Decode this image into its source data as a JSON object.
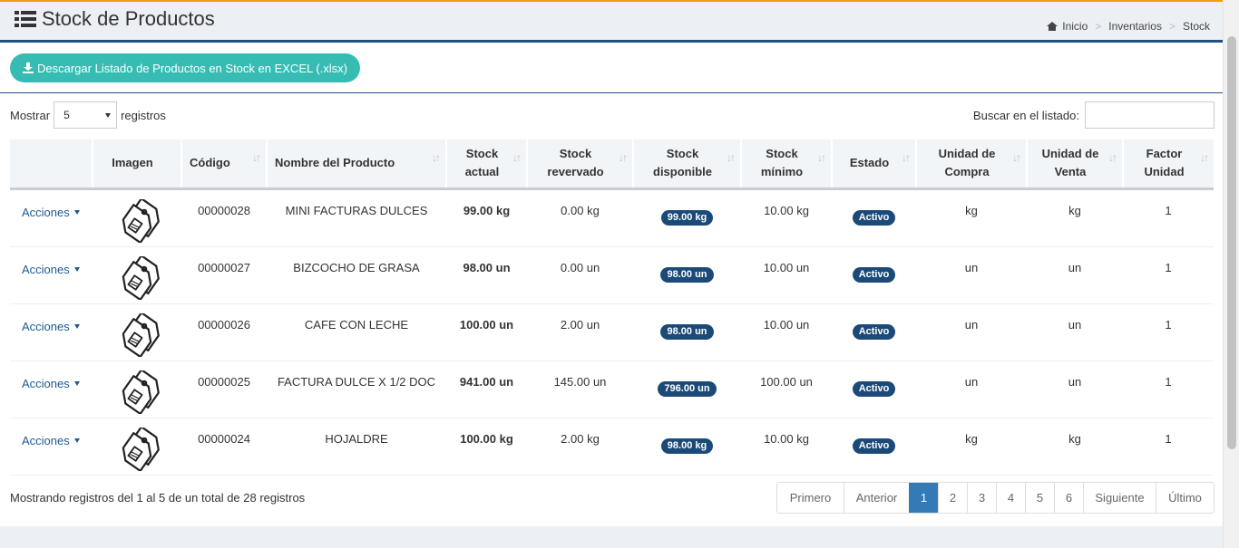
{
  "header": {
    "title": "Stock de Productos",
    "breadcrumb": [
      "Inicio",
      "Inventarios",
      "Stock"
    ]
  },
  "toolbar": {
    "download_label": "Descargar Listado de Productos en Stock en EXCEL (.xlsx)"
  },
  "controls": {
    "show_label": "Mostrar",
    "page_length": "5",
    "records_label": "registros",
    "search_label": "Buscar en el listado:",
    "search_value": ""
  },
  "table": {
    "columns": [
      "",
      "Imagen",
      "Código",
      "Nombre del Producto",
      "Stock actual",
      "Stock revervado",
      "Stock disponible",
      "Stock mínimo",
      "Estado",
      "Unidad de Compra",
      "Unidad de Venta",
      "Factor Unidad"
    ],
    "actions_label": "Acciones",
    "rows": [
      {
        "codigo": "00000028",
        "nombre": "MINI FACTURAS DULCES",
        "actual": "99.00 kg",
        "reservado": "0.00 kg",
        "disponible": "99.00 kg",
        "minimo": "10.00 kg",
        "estado": "Activo",
        "compra": "kg",
        "venta": "kg",
        "factor": "1"
      },
      {
        "codigo": "00000027",
        "nombre": "BIZCOCHO DE GRASA",
        "actual": "98.00 un",
        "reservado": "0.00 un",
        "disponible": "98.00 un",
        "minimo": "10.00 un",
        "estado": "Activo",
        "compra": "un",
        "venta": "un",
        "factor": "1"
      },
      {
        "codigo": "00000026",
        "nombre": "CAFE CON LECHE",
        "actual": "100.00 un",
        "reservado": "2.00 un",
        "disponible": "98.00 un",
        "minimo": "10.00 un",
        "estado": "Activo",
        "compra": "un",
        "venta": "un",
        "factor": "1"
      },
      {
        "codigo": "00000025",
        "nombre": "FACTURA DULCE X 1/2 DOC",
        "actual": "941.00 un",
        "reservado": "145.00 un",
        "disponible": "796.00 un",
        "minimo": "100.00 un",
        "estado": "Activo",
        "compra": "un",
        "venta": "un",
        "factor": "1"
      },
      {
        "codigo": "00000024",
        "nombre": "HOJALDRE",
        "actual": "100.00 kg",
        "reservado": "2.00 kg",
        "disponible": "98.00 kg",
        "minimo": "10.00 kg",
        "estado": "Activo",
        "compra": "kg",
        "venta": "kg",
        "factor": "1"
      }
    ]
  },
  "footer": {
    "info": "Mostrando registros del 1 al 5 de un total de 28 registros",
    "pagination": [
      "Primero",
      "Anterior",
      "1",
      "2",
      "3",
      "4",
      "5",
      "6",
      "Siguiente",
      "Último"
    ],
    "active_page": "1"
  },
  "colors": {
    "accent": "#205081",
    "button": "#37bcb4",
    "badge": "#1b4a78",
    "active_page": "#337ab7"
  }
}
